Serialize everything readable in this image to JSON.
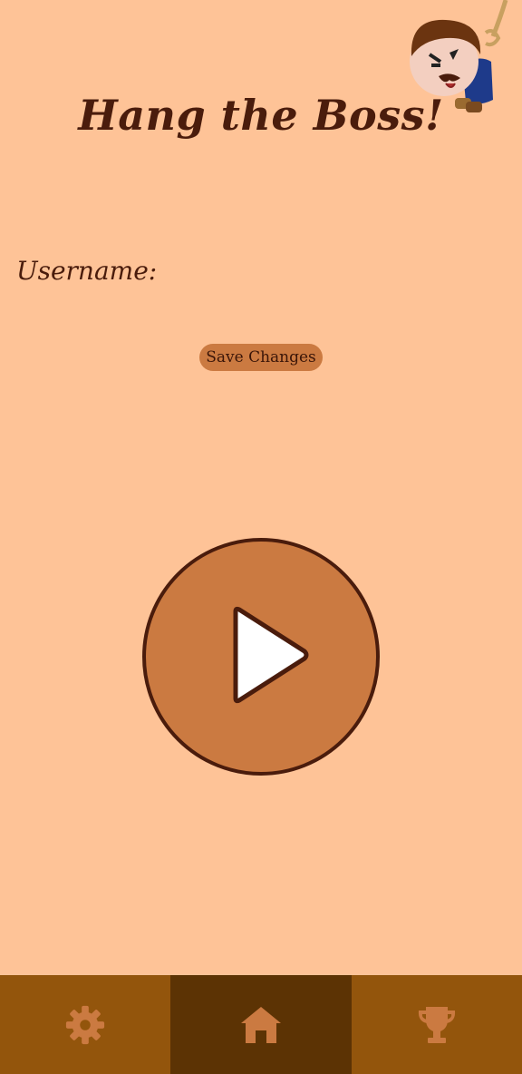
{
  "header": {
    "title": "Hang the Boss!"
  },
  "profile": {
    "username_label": "Username:",
    "username_value": "",
    "save_label": "Save Changes"
  },
  "nav": {
    "items": [
      {
        "icon": "gear-icon"
      },
      {
        "icon": "home-icon",
        "active": true
      },
      {
        "icon": "trophy-icon"
      }
    ]
  },
  "colors": {
    "background": "#FEC397",
    "accent": "#CB7A41",
    "outline": "#4A1C0C",
    "nav_bg": "#93550C",
    "nav_active": "#5C3304"
  }
}
